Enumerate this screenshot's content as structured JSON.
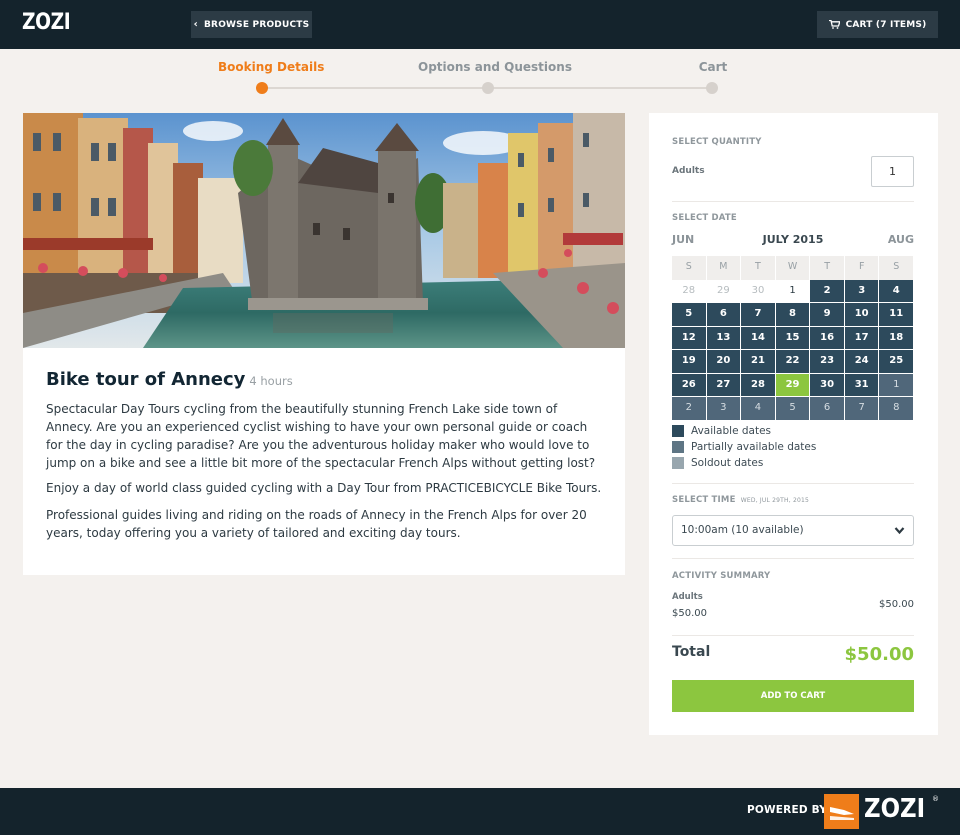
{
  "header": {
    "logo": "ZOZI",
    "browse_label": "BROWSE PRODUCTS",
    "cart_label": "CART (7 ITEMS)"
  },
  "stepper": {
    "steps": [
      {
        "label": "Booking Details",
        "active": true
      },
      {
        "label": "Options and Questions",
        "active": false
      },
      {
        "label": "Cart",
        "active": false
      }
    ]
  },
  "tour": {
    "title": "Bike tour of Annecy",
    "duration": "4 hours",
    "paragraphs": [
      "Spectacular Day Tours cycling from the beautifully stunning French Lake side town of Annecy. Are you an experienced cyclist wishing to have your own personal guide or coach for the day in cycling paradise? Are you the adventurous holiday maker who would love to jump on a bike and see a little bit more of the spectacular French Alps without getting lost?",
      "Enjoy a day of world class guided cycling with a Day Tour from PRACTICEBICYCLE Bike Tours.",
      "Professional guides living and riding on the roads of Annecy in the French Alps for over 20 years, today offering you a variety of tailored and exciting day tours."
    ]
  },
  "booking": {
    "quantity_label": "SELECT QUANTITY",
    "adults_label": "Adults",
    "adults_value": "1",
    "date_label": "SELECT DATE",
    "prev_month": "JUN",
    "current_month": "JULY 2015",
    "next_month": "AUG",
    "weekdays": [
      "S",
      "M",
      "T",
      "W",
      "T",
      "F",
      "S"
    ],
    "weeks": [
      [
        {
          "d": "28",
          "s": "past"
        },
        {
          "d": "29",
          "s": "past"
        },
        {
          "d": "30",
          "s": "past"
        },
        {
          "d": "1",
          "s": "plain"
        },
        {
          "d": "2",
          "s": "avail"
        },
        {
          "d": "3",
          "s": "avail"
        },
        {
          "d": "4",
          "s": "avail"
        }
      ],
      [
        {
          "d": "5",
          "s": "avail"
        },
        {
          "d": "6",
          "s": "avail"
        },
        {
          "d": "7",
          "s": "avail"
        },
        {
          "d": "8",
          "s": "avail"
        },
        {
          "d": "9",
          "s": "avail"
        },
        {
          "d": "10",
          "s": "avail"
        },
        {
          "d": "11",
          "s": "avail"
        }
      ],
      [
        {
          "d": "12",
          "s": "avail"
        },
        {
          "d": "13",
          "s": "avail"
        },
        {
          "d": "14",
          "s": "avail"
        },
        {
          "d": "15",
          "s": "avail"
        },
        {
          "d": "16",
          "s": "avail"
        },
        {
          "d": "17",
          "s": "avail"
        },
        {
          "d": "18",
          "s": "avail"
        }
      ],
      [
        {
          "d": "19",
          "s": "avail"
        },
        {
          "d": "20",
          "s": "avail"
        },
        {
          "d": "21",
          "s": "avail"
        },
        {
          "d": "22",
          "s": "avail"
        },
        {
          "d": "23",
          "s": "avail"
        },
        {
          "d": "24",
          "s": "avail"
        },
        {
          "d": "25",
          "s": "avail"
        }
      ],
      [
        {
          "d": "26",
          "s": "avail"
        },
        {
          "d": "27",
          "s": "avail"
        },
        {
          "d": "28",
          "s": "avail"
        },
        {
          "d": "29",
          "s": "sel"
        },
        {
          "d": "30",
          "s": "avail"
        },
        {
          "d": "31",
          "s": "avail"
        },
        {
          "d": "1",
          "s": "next-m"
        }
      ],
      [
        {
          "d": "2",
          "s": "next-m"
        },
        {
          "d": "3",
          "s": "next-m"
        },
        {
          "d": "4",
          "s": "next-m"
        },
        {
          "d": "5",
          "s": "next-m"
        },
        {
          "d": "6",
          "s": "next-m"
        },
        {
          "d": "7",
          "s": "next-m"
        },
        {
          "d": "8",
          "s": "next-m"
        }
      ]
    ],
    "legend": [
      {
        "label": "Available dates",
        "color": "#2d4a5c"
      },
      {
        "label": "Partially available dates",
        "color": "#5e7584"
      },
      {
        "label": "Soldout dates",
        "color": "#98a6ae"
      }
    ],
    "time_label": "SELECT TIME",
    "time_date": "WED, JUL 29TH, 2015",
    "time_value": "10:00am (10 available)",
    "summary_label": "ACTIVITY SUMMARY",
    "summary_adults": "Adults",
    "summary_price_left": "$50.00",
    "summary_price_right": "$50.00",
    "total_label": "Total",
    "total_value": "$50.00",
    "add_to_cart": "ADD TO CART"
  },
  "footer": {
    "powered_by": "POWERED BY",
    "logo": "ZOZI",
    "reg": "®"
  },
  "colors": {
    "nav_bg": "#14232c",
    "accent_orange": "#ef7d1a",
    "accent_green": "#8cc63f",
    "calendar_available": "#2d4a5c"
  }
}
